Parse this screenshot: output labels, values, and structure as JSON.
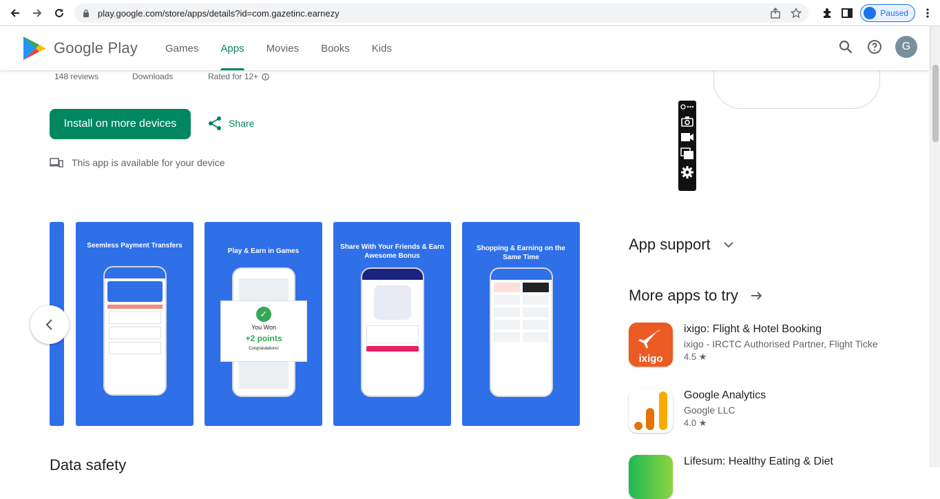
{
  "browser": {
    "url": "play.google.com/store/apps/details?id=com.gazetinc.earnezy",
    "profile_label": "Paused"
  },
  "header": {
    "brand": "Google Play",
    "tabs": [
      {
        "label": "Games"
      },
      {
        "label": "Apps"
      },
      {
        "label": "Movies"
      },
      {
        "label": "Books"
      },
      {
        "label": "Kids"
      }
    ],
    "active_tab": "Apps",
    "avatar_letter": "G"
  },
  "app": {
    "reviews_label": "148 reviews",
    "downloads_label": "Downloads",
    "rated_label": "Rated for 12+",
    "install_label": "Install on more devices",
    "share_label": "Share",
    "availability": "This app is available for your device"
  },
  "screenshots": [
    {
      "caption": "Seemless Payment Transfers"
    },
    {
      "caption": "Play & Earn in Games",
      "popup_title": "You Won",
      "popup_points": "+2 points",
      "popup_msg": "Congratulations!"
    },
    {
      "caption": "Share With Your Friends & Earn Awesome Bonus"
    },
    {
      "caption": "Shopping & Earning on the Same Time"
    }
  ],
  "sections": {
    "data_safety": "Data safety",
    "app_support": "App support",
    "more_apps": "More apps to try"
  },
  "more_apps": [
    {
      "title": "ixigo: Flight & Hotel Booking",
      "developer": "ixigo - IRCTC Authorised Partner, Flight Ticke",
      "rating": "4.5",
      "icon_label": "ixigo",
      "color": "#ec5b24"
    },
    {
      "title": "Google Analytics",
      "developer": "Google LLC",
      "rating": "4.0",
      "color": "#f9ab00"
    },
    {
      "title": "Lifesum: Healthy Eating & Diet",
      "developer": "",
      "rating": "",
      "color": "#1fb855"
    }
  ],
  "colors": {
    "accent": "#01875f",
    "screenshot_bg": "#2f6fe8"
  }
}
